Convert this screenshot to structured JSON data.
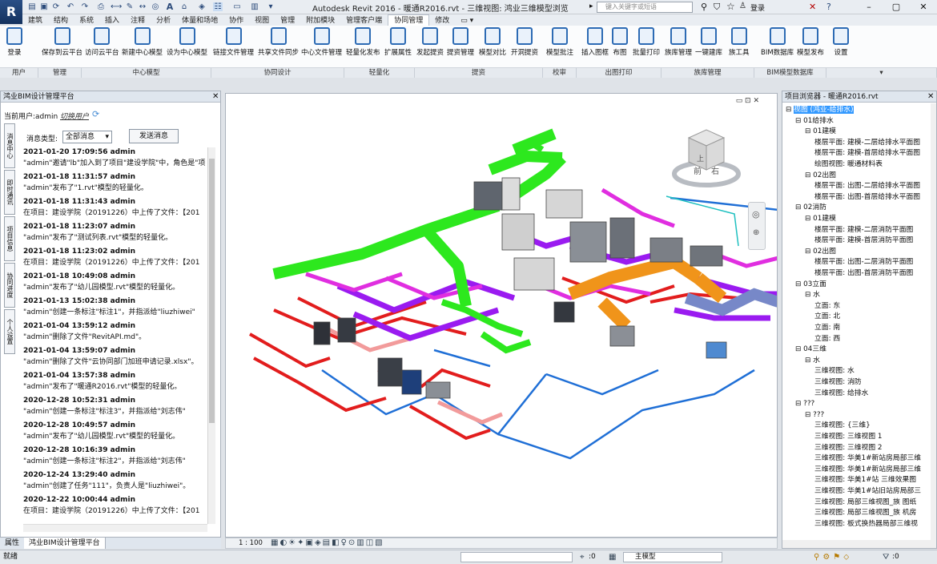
{
  "app": {
    "title": "Autodesk Revit 2016 -    暖通R2016.rvt - 三维视图: 鸿业三维模型浏览",
    "search_placeholder": "键入关键字或短语",
    "login_label": "登录"
  },
  "tabs": [
    "建筑",
    "结构",
    "系统",
    "插入",
    "注释",
    "分析",
    "体量和场地",
    "协作",
    "视图",
    "管理",
    "附加模块",
    "管理客户端",
    "协同管理",
    "修改"
  ],
  "active_tab": "协同管理",
  "ribbon": {
    "buttons": [
      "登录",
      "保存到云平台",
      "访问云平台",
      "新建中心模型",
      "设为中心模型",
      "链接文件管理",
      "共享文件同步",
      "中心文件管理",
      "轻量化发布",
      "扩展属性",
      "发起提资",
      "提资管理",
      "模型对比",
      "开洞提资",
      "模型批注",
      "插入图框",
      "布图",
      "批量打印",
      "族库管理",
      "一键建库",
      "族工具",
      "BIM数据库",
      "模型发布",
      "设置"
    ],
    "groups": [
      "用户",
      "管理",
      "中心模型",
      "协同设计",
      "轻量化",
      "提资",
      "校审",
      "出图打印",
      "族库管理",
      "BIM模型数据库"
    ]
  },
  "left_panel": {
    "title": "鸿业BIM设计管理平台",
    "current_user_label": "当前用户:admin",
    "switch_user_label": "切换用户",
    "msg_type_label": "消息类型:",
    "msg_type_value": "全部消息",
    "send_button": "发送消息",
    "side_tabs": [
      "消息中心",
      "即时通讯",
      "项目信息",
      "协同进度",
      "个人设置"
    ],
    "messages": [
      {
        "time": "2021-01-20 17:09:56 admin",
        "text": "\"admin\"邀请\"lb\"加入到了项目\"建设学院\"中，角色是\"项"
      },
      {
        "time": "2021-01-18 11:31:57 admin",
        "text": "\"admin\"发布了\"1.rvt\"模型的轻量化。"
      },
      {
        "time": "2021-01-18 11:31:43 admin",
        "text": "在项目：建设学院（20191226）中上传了文件：【201"
      },
      {
        "time": "2021-01-18 11:23:07 admin",
        "text": "\"admin\"发布了\"测试列表.rvt\"模型的轻量化。"
      },
      {
        "time": "2021-01-18 11:23:02 admin",
        "text": "在项目：建设学院（20191226）中上传了文件：【201"
      },
      {
        "time": "2021-01-18 10:49:08 admin",
        "text": "\"admin\"发布了\"幼儿园模型.rvt\"模型的轻量化。"
      },
      {
        "time": "2021-01-13 15:02:38 admin",
        "text": "\"admin\"创建一条标注\"标注1\"，并指派给\"liuzhiwei\""
      },
      {
        "time": "2021-01-04 13:59:12 admin",
        "text": "\"admin\"删除了文件\"RevitAPI.md\"。"
      },
      {
        "time": "2021-01-04 13:59:07 admin",
        "text": "\"admin\"删除了文件\"云协同部门加班申请记录.xlsx\"。"
      },
      {
        "time": "2021-01-04 13:57:38 admin",
        "text": "\"admin\"发布了\"暖通R2016.rvt\"模型的轻量化。"
      },
      {
        "time": "2020-12-28 10:52:31 admin",
        "text": "\"admin\"创建一条标注\"标注3\"，并指派给\"刘志伟\""
      },
      {
        "time": "2020-12-28 10:49:57 admin",
        "text": "\"admin\"发布了\"幼儿园模型.rvt\"模型的轻量化。"
      },
      {
        "time": "2020-12-28 10:16:39 admin",
        "text": "\"admin\"创建一条标注\"标注2\"，并指派给\"刘志伟\""
      },
      {
        "time": "2020-12-24 13:29:40 admin",
        "text": "\"admin\"创建了任务\"111\"，负责人是\"liuzhiwei\"。"
      },
      {
        "time": "2020-12-22 10:00:44 admin",
        "text": "在项目：建设学院（20191226）中上传了文件：【201"
      }
    ],
    "bottom_tabs": [
      "属性",
      "鸿业BIM设计管理平台"
    ]
  },
  "viewport": {
    "scale": "1 : 100",
    "viewcube_front": "前",
    "viewcube_right": "右",
    "viewcube_top": "上"
  },
  "right_panel": {
    "title": "项目浏览器 - 暖通R2016.rvt",
    "tree": [
      {
        "level": 0,
        "sign": "⊟",
        "text": "视图 (鸿业-给排水)",
        "selected": true
      },
      {
        "level": 1,
        "sign": "⊟",
        "text": "01给排水"
      },
      {
        "level": 2,
        "sign": "⊟",
        "text": "01建模"
      },
      {
        "level": 3,
        "sign": "",
        "text": "楼层平面: 建模-二层给排水平面图"
      },
      {
        "level": 3,
        "sign": "",
        "text": "楼层平面: 建模-首层给排水平面图"
      },
      {
        "level": 3,
        "sign": "",
        "text": "绘图视图: 暖通材料表"
      },
      {
        "level": 2,
        "sign": "⊟",
        "text": "02出图"
      },
      {
        "level": 3,
        "sign": "",
        "text": "楼层平面: 出图-二层给排水平面图"
      },
      {
        "level": 3,
        "sign": "",
        "text": "楼层平面: 出图-首层给排水平面图"
      },
      {
        "level": 1,
        "sign": "⊟",
        "text": "02消防"
      },
      {
        "level": 2,
        "sign": "⊟",
        "text": "01建模"
      },
      {
        "level": 3,
        "sign": "",
        "text": "楼层平面: 建模-二层消防平面图"
      },
      {
        "level": 3,
        "sign": "",
        "text": "楼层平面: 建模-首层消防平面图"
      },
      {
        "level": 2,
        "sign": "⊟",
        "text": "02出图"
      },
      {
        "level": 3,
        "sign": "",
        "text": "楼层平面: 出图-二层消防平面图"
      },
      {
        "level": 3,
        "sign": "",
        "text": "楼层平面: 出图-首层消防平面图"
      },
      {
        "level": 1,
        "sign": "⊟",
        "text": "03立面"
      },
      {
        "level": 2,
        "sign": "⊟",
        "text": "水"
      },
      {
        "level": 3,
        "sign": "",
        "text": "立面: 东"
      },
      {
        "level": 3,
        "sign": "",
        "text": "立面: 北"
      },
      {
        "level": 3,
        "sign": "",
        "text": "立面: 南"
      },
      {
        "level": 3,
        "sign": "",
        "text": "立面: 西"
      },
      {
        "level": 1,
        "sign": "⊟",
        "text": "04三维"
      },
      {
        "level": 2,
        "sign": "⊟",
        "text": "水"
      },
      {
        "level": 3,
        "sign": "",
        "text": "三维视图: 水"
      },
      {
        "level": 3,
        "sign": "",
        "text": "三维视图: 消防"
      },
      {
        "level": 3,
        "sign": "",
        "text": "三维视图: 给排水"
      },
      {
        "level": 1,
        "sign": "⊟",
        "text": "???"
      },
      {
        "level": 2,
        "sign": "⊟",
        "text": "???"
      },
      {
        "level": 3,
        "sign": "",
        "text": "三维视图: {三维}"
      },
      {
        "level": 3,
        "sign": "",
        "text": "三维视图: 三维视图 1"
      },
      {
        "level": 3,
        "sign": "",
        "text": "三维视图: 三维视图 2"
      },
      {
        "level": 3,
        "sign": "",
        "text": "三维视图: 华美1#新站房局部三维"
      },
      {
        "level": 3,
        "sign": "",
        "text": "三维视图: 华美1#新站房局部三维"
      },
      {
        "level": 3,
        "sign": "",
        "text": "三维视图: 华美1#站 三维效果图"
      },
      {
        "level": 3,
        "sign": "",
        "text": "三维视图: 华美1#站旧站房局部三"
      },
      {
        "level": 3,
        "sign": "",
        "text": "三维视图: 局部三维视图_族 图纸"
      },
      {
        "level": 3,
        "sign": "",
        "text": "三维视图: 局部三维视图_族 机房"
      },
      {
        "level": 3,
        "sign": "",
        "text": "三维视图: 板式换热器局部三维视"
      }
    ]
  },
  "status": {
    "left": "就绪",
    "sel_count": ":0",
    "model_label": "主模型",
    "right_count": ":0"
  }
}
